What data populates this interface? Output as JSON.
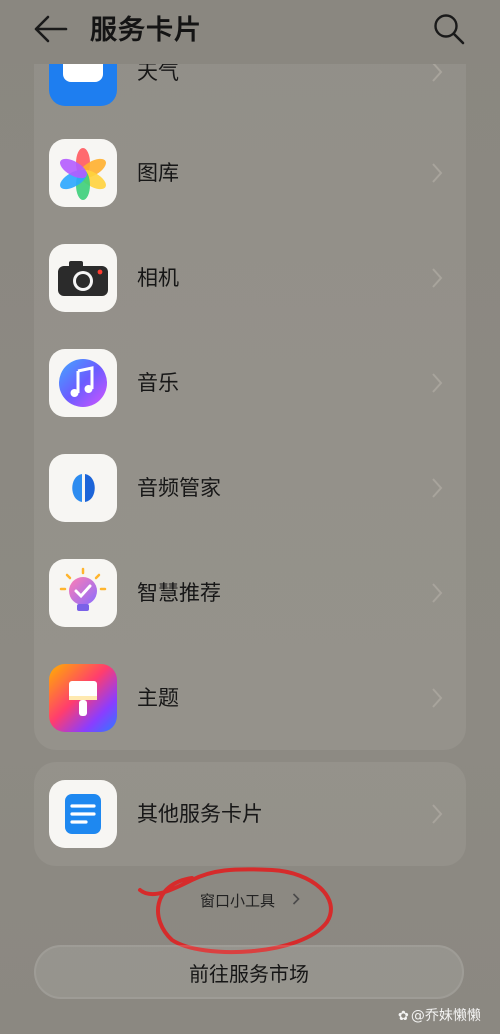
{
  "header": {
    "title": "服务卡片"
  },
  "apps": [
    {
      "label": "天气",
      "icon": "weather-icon"
    },
    {
      "label": "图库",
      "icon": "gallery-icon"
    },
    {
      "label": "相机",
      "icon": "camera-icon"
    },
    {
      "label": "音乐",
      "icon": "music-icon"
    },
    {
      "label": "音频管家",
      "icon": "audio-manager-icon"
    },
    {
      "label": "智慧推荐",
      "icon": "smart-recommend-icon"
    },
    {
      "label": "主题",
      "icon": "theme-icon"
    }
  ],
  "other": {
    "label": "其他服务卡片",
    "icon": "other-cards-icon"
  },
  "widget_link": {
    "label": "窗口小工具"
  },
  "market_button": {
    "label": "前往服务市场"
  },
  "watermark": {
    "text": "@乔妹懒懒"
  },
  "colors": {
    "background": "#8a8780",
    "annotation": "#d62b2b",
    "accent_blue": "#1e7ef0"
  }
}
